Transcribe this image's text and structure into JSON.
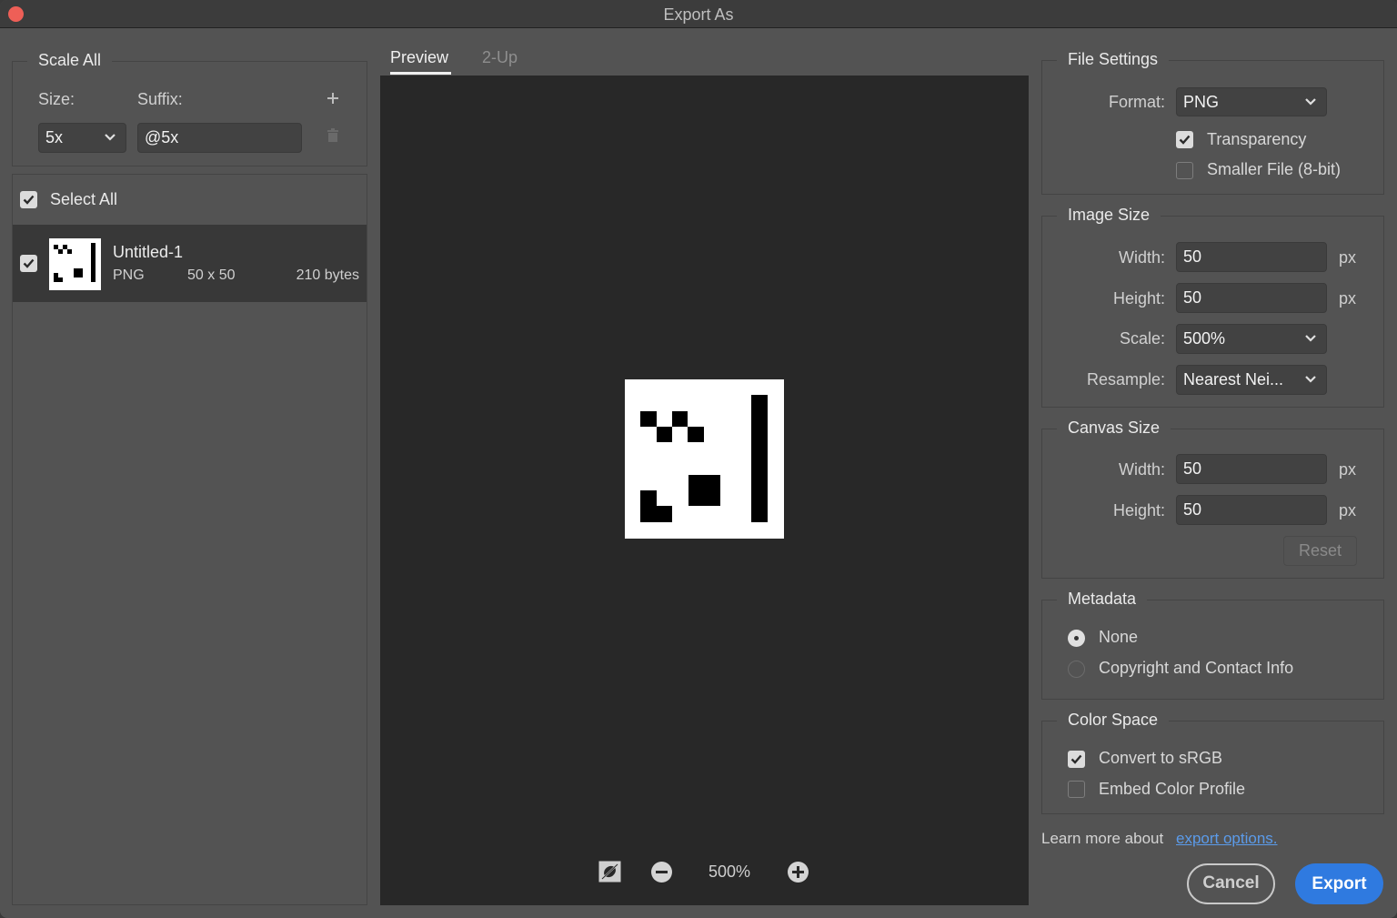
{
  "window": {
    "title": "Export As"
  },
  "scale_all": {
    "legend": "Scale All",
    "size_label": "Size:",
    "suffix_label": "Suffix:",
    "size_value": "5x",
    "suffix_value": "@5x",
    "add_icon": "plus-icon",
    "delete_icon": "trash-icon"
  },
  "asset_list": {
    "select_all_label": "Select All",
    "select_all_checked": true,
    "items": [
      {
        "name": "Untitled-1",
        "format": "PNG",
        "dimensions": "50 x 50",
        "size": "210 bytes",
        "checked": true
      }
    ]
  },
  "preview": {
    "tabs": [
      {
        "label": "Preview",
        "active": true
      },
      {
        "label": "2-Up",
        "active": false
      }
    ],
    "zoom_level": "500%",
    "toolbar_icons": [
      "toggle-background-icon",
      "zoom-out-icon",
      "zoom-in-icon"
    ]
  },
  "file_settings": {
    "legend": "File Settings",
    "format_label": "Format:",
    "format_value": "PNG",
    "transparency_label": "Transparency",
    "transparency_checked": true,
    "smaller_file_label": "Smaller File (8-bit)",
    "smaller_file_checked": false
  },
  "image_size": {
    "legend": "Image Size",
    "width_label": "Width:",
    "width_value": "50",
    "height_label": "Height:",
    "height_value": "50",
    "unit": "px",
    "scale_label": "Scale:",
    "scale_value": "500%",
    "resample_label": "Resample:",
    "resample_value": "Nearest Nei..."
  },
  "canvas_size": {
    "legend": "Canvas Size",
    "width_label": "Width:",
    "width_value": "50",
    "height_label": "Height:",
    "height_value": "50",
    "unit": "px",
    "reset_label": "Reset"
  },
  "metadata": {
    "legend": "Metadata",
    "options": [
      {
        "label": "None",
        "selected": true
      },
      {
        "label": "Copyright and Contact Info",
        "selected": false
      }
    ]
  },
  "color_space": {
    "legend": "Color Space",
    "convert_label": "Convert to sRGB",
    "convert_checked": true,
    "embed_label": "Embed Color Profile",
    "embed_checked": false
  },
  "footer": {
    "learn_text": "Learn more about",
    "link_text": "export options.",
    "cancel_label": "Cancel",
    "export_label": "Export"
  },
  "colors": {
    "accent": "#2f7ae0",
    "link": "#5b9bea",
    "close": "#ee5f57"
  }
}
